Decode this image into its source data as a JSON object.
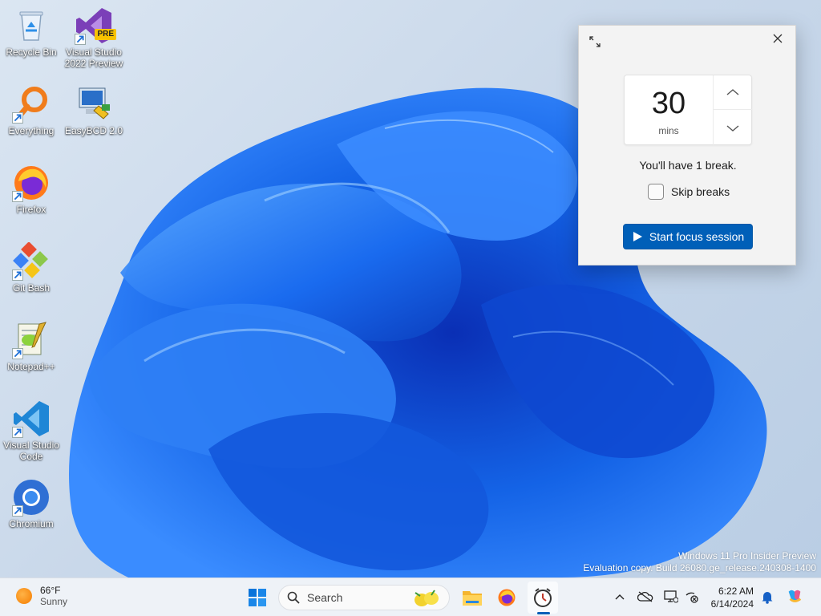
{
  "desktop_icons": [
    {
      "label": "Recycle Bin",
      "icon": "recycle-bin-icon"
    },
    {
      "label": "Visual Studio 2022 Preview",
      "icon": "visual-studio-preview-icon",
      "badge": "PRE"
    },
    {
      "label": "Everything",
      "icon": "everything-search-icon"
    },
    {
      "label": "EasyBCD 2.0",
      "icon": "easybcd-icon"
    },
    {
      "label": "Firefox",
      "icon": "firefox-icon"
    },
    {
      "label": "Git Bash",
      "icon": "git-bash-icon"
    },
    {
      "label": "Notepad++",
      "icon": "notepad-plus-plus-icon"
    },
    {
      "label": "Visual Studio Code",
      "icon": "vscode-icon"
    },
    {
      "label": "Chromium",
      "icon": "chromium-icon"
    }
  ],
  "focus_panel": {
    "expand_icon": "expand-icon",
    "close_icon": "close-icon",
    "duration_value": "30",
    "duration_unit": "mins",
    "breaks_text": "You'll have 1 break.",
    "skip_breaks_label": "Skip breaks",
    "skip_breaks_checked": false,
    "start_button_label": "Start focus session",
    "accent_color": "#005fb8"
  },
  "watermark": {
    "line1": "Windows 11 Pro Insider Preview",
    "line2": "Evaluation copy. Build 26080.ge_release.240308-1400"
  },
  "taskbar": {
    "weather": {
      "temp": "66°F",
      "condition": "Sunny"
    },
    "search_placeholder": "Search",
    "pinned": [
      "start-icon",
      "file-explorer-icon",
      "firefox-icon",
      "clock-app-icon"
    ],
    "tray": [
      "chevron-up-icon",
      "onedrive-offline-icon",
      "display-icon",
      "network-off-icon"
    ],
    "time": "6:22 AM",
    "date": "6/14/2024"
  }
}
